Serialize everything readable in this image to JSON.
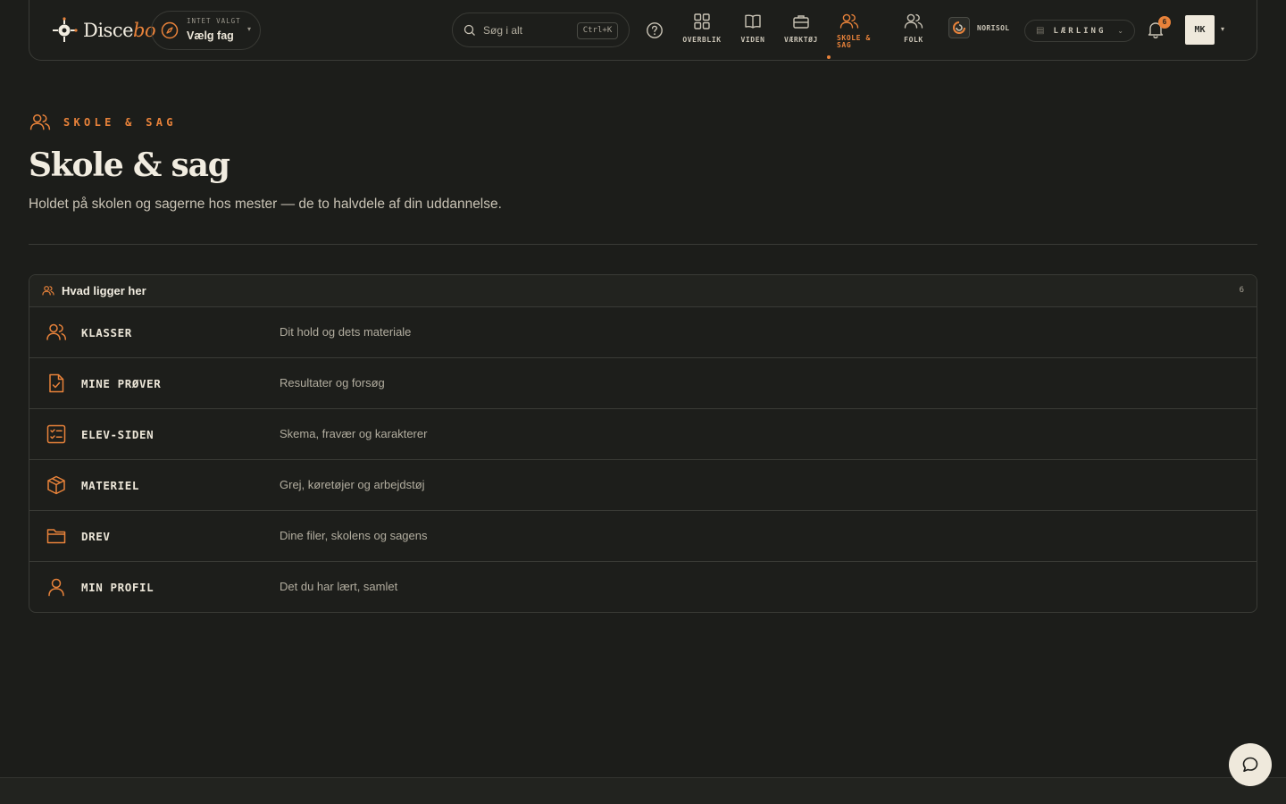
{
  "brand": {
    "name_main": "Disce",
    "name_accent": "bo"
  },
  "subject": {
    "kicker": "INTET VALGT",
    "value": "Vælg fag",
    "caret": "▾"
  },
  "search": {
    "placeholder": "Søg i alt",
    "shortcut": "Ctrl+K"
  },
  "nav": {
    "items": [
      {
        "label": "OVERBLIK",
        "icon": "grid-icon"
      },
      {
        "label": "VIDEN",
        "icon": "book-icon"
      },
      {
        "label": "VÆRKTØJ",
        "icon": "briefcase-icon"
      },
      {
        "label_line1": "SKOLE &",
        "label_line2": "SAG",
        "icon": "users-icon",
        "active": true
      },
      {
        "label": "FOLK",
        "icon": "users-icon"
      }
    ]
  },
  "org": {
    "name": "NORISOL"
  },
  "role": {
    "label": "LÆRLING",
    "caret": "⌄"
  },
  "notifications": {
    "count": "6"
  },
  "user": {
    "initials": "MK",
    "caret": "▾"
  },
  "page": {
    "kicker": "SKOLE & SAG",
    "title": "Skole & sag",
    "subtitle": "Holdet på skolen og sagerne hos mester — de to halvdele af din uddannelse."
  },
  "list": {
    "title": "Hvad ligger her",
    "count": "6",
    "rows": [
      {
        "name": "KLASSER",
        "desc": "Dit hold og dets materiale",
        "icon": "users-icon"
      },
      {
        "name": "MINE PRØVER",
        "desc": "Resultater og forsøg",
        "icon": "file-check-icon"
      },
      {
        "name": "ELEV-SIDEN",
        "desc": "Skema, fravær og karakterer",
        "icon": "checklist-icon"
      },
      {
        "name": "MATERIEL",
        "desc": "Grej, køretøjer og arbejdstøj",
        "icon": "box-icon"
      },
      {
        "name": "DREV",
        "desc": "Dine filer, skolens og sagens",
        "icon": "folder-icon"
      },
      {
        "name": "MIN PROFIL",
        "desc": "Det du har lært, samlet",
        "icon": "user-icon"
      }
    ]
  },
  "colors": {
    "accent": "#e8823a",
    "background": "#1c1d1a",
    "text": "#ece6d8",
    "border": "#3a3b36"
  }
}
